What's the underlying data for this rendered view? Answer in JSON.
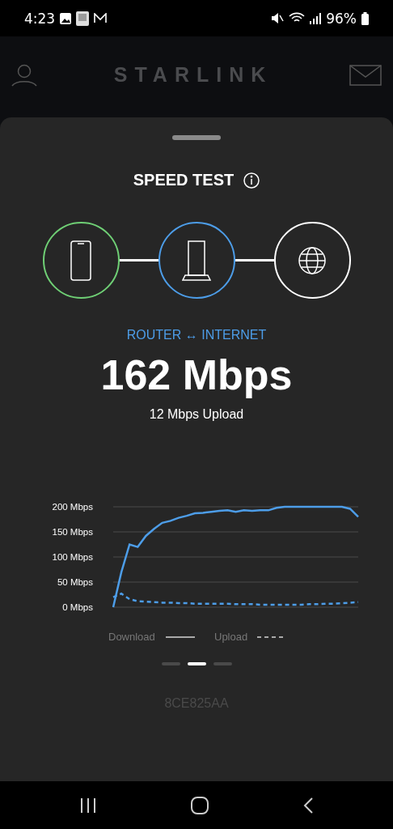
{
  "status_bar": {
    "time": "4:23",
    "battery": "96%"
  },
  "header": {
    "title": "STARLINK"
  },
  "sheet": {
    "title": "SPEED TEST",
    "nodes": [
      {
        "kind": "phone",
        "color": "#6fcf75"
      },
      {
        "kind": "router",
        "color": "#4d9de8"
      },
      {
        "kind": "globe",
        "color": "#ffffff"
      }
    ],
    "link_label": "ROUTER ↔ INTERNET",
    "speed": "162 Mbps",
    "upload": "12 Mbps Upload",
    "chart": {
      "chart_data": {
        "type": "line",
        "grid": true,
        "ylim": [
          0,
          200
        ],
        "yticks": [
          {
            "value": 0,
            "label": "0 Mbps"
          },
          {
            "value": 50,
            "label": "50 Mbps"
          },
          {
            "value": 100,
            "label": "100 Mbps"
          },
          {
            "value": 150,
            "label": "150 Mbps"
          },
          {
            "value": 200,
            "label": "200 Mbps"
          }
        ],
        "series": [
          {
            "name": "Download",
            "color": "#4d9de8",
            "line_style": "solid",
            "values": [
              0,
              70,
              125,
              120,
              142,
              156,
              168,
              172,
              178,
              182,
              187,
              188,
              190,
              192,
              193,
              190,
              193,
              192,
              193,
              193,
              198,
              200,
              200,
              200,
              200,
              200,
              200,
              200,
              200,
              196,
              180
            ]
          },
          {
            "name": "Upload",
            "color": "#4d9de8",
            "line_style": "dashed",
            "values": [
              20,
              27,
              16,
              12,
              11,
              10,
              9,
              9,
              8,
              8,
              7,
              7,
              7,
              7,
              7,
              6,
              6,
              6,
              5,
              5,
              5,
              5,
              5,
              5,
              6,
              6,
              7,
              7,
              8,
              9,
              10
            ]
          }
        ]
      }
    },
    "pages": [
      {
        "selected": false
      },
      {
        "selected": true
      },
      {
        "selected": false
      }
    ],
    "device_id": "8CE825AA"
  }
}
